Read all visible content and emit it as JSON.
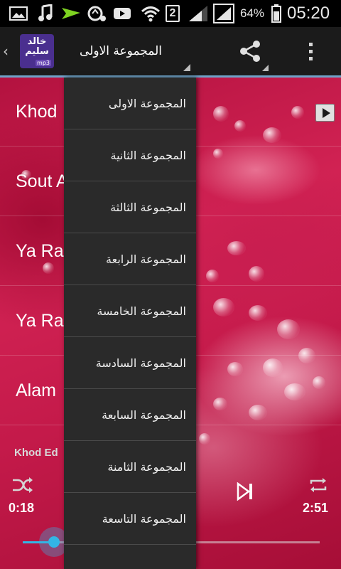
{
  "status_bar": {
    "signal_slot": "2",
    "battery_percent": "64%",
    "clock": "05:20"
  },
  "action_bar": {
    "logo": {
      "line1": "خالد",
      "line2": "سليم",
      "tag": "mp3"
    },
    "spinner_selected": "المجموعة الاولى"
  },
  "songs": [
    {
      "title": "Khod"
    },
    {
      "title": "Sout A"
    },
    {
      "title": "Ya Ra"
    },
    {
      "title": "Ya Ra"
    },
    {
      "title": "Alam"
    }
  ],
  "dropdown": {
    "items": [
      "المجموعة الاولى",
      "المجموعة الثانية",
      "المجموعة الثالثة",
      "المجموعة الرابعة",
      "المجموعة الخامسة",
      "المجموعة السادسة",
      "المجموعة السابعة",
      "المجموعة الثامنة",
      "المجموعة التاسعة"
    ]
  },
  "player": {
    "now_playing": "Khod Ed",
    "elapsed": "0:18",
    "total": "2:51",
    "progress_fraction": 0.105
  },
  "colors": {
    "accent": "#33b5e5",
    "action_bar": "#1b1b1b",
    "action_bar_underline": "#6fa3c9",
    "dropdown_bg": "#2a2a2a"
  },
  "icons": {
    "status": [
      "gallery-icon",
      "music-icon",
      "send-icon",
      "voicemail-icon",
      "youtube-icon",
      "wifi-icon",
      "signal-icon",
      "battery-icon"
    ],
    "action_bar": [
      "up-arrow-icon",
      "share-icon",
      "overflow-menu-icon"
    ],
    "player": [
      "shuffle-icon",
      "next-icon",
      "repeat-icon",
      "play-icon"
    ]
  }
}
